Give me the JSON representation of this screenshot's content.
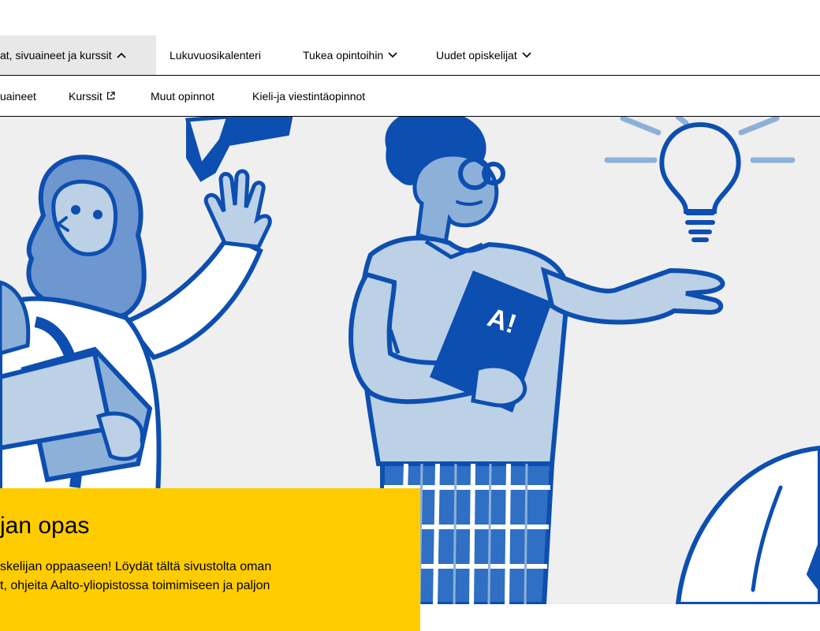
{
  "primary_nav": {
    "items": [
      {
        "label": "at, sivuaineet ja kurssit",
        "chevron": "up",
        "active": true
      },
      {
        "label": "Lukuvuosikalenteri",
        "chevron": "",
        "active": false
      },
      {
        "label": "Tukea opintoihin",
        "chevron": "down",
        "active": false
      },
      {
        "label": "Uudet opiskelijat",
        "chevron": "down",
        "active": false
      }
    ]
  },
  "secondary_nav": {
    "items": [
      {
        "label": "uaineet",
        "external": false
      },
      {
        "label": "Kurssit",
        "external": true
      },
      {
        "label": "Muut opinnot",
        "external": false
      },
      {
        "label": "Kieli-ja viestintäopinnot",
        "external": false
      }
    ]
  },
  "hero": {
    "title": "jan opas",
    "text_line_1": "skelijan oppaaseen! Löydät tältä sivustolta oman",
    "text_line_2": "t, ohjeita Aalto-yliopistossa toimimiseen ja paljon",
    "book_label": "A!",
    "colors": {
      "background": "#efefef",
      "light_blue": "#bcd0e6",
      "mid_blue": "#8db0d8",
      "dark_blue": "#0d4fb0",
      "card_yellow": "#ffcc00"
    }
  }
}
